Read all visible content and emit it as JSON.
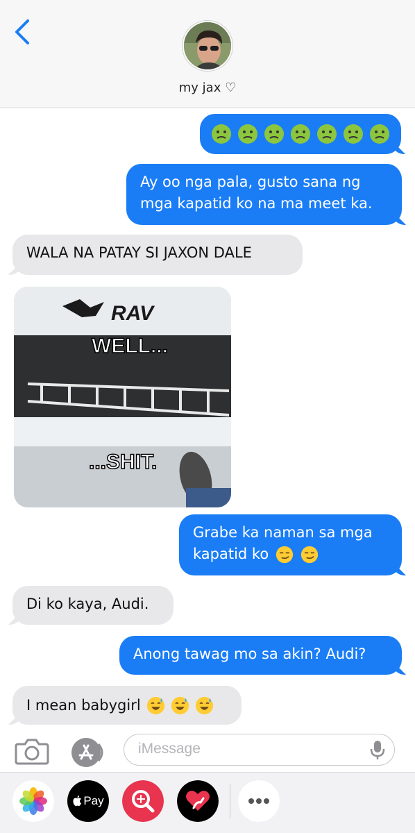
{
  "header": {
    "contact_name": "my jax ♡"
  },
  "messages": [
    {
      "side": "sent",
      "emoji": "nauseated-face-emoji",
      "emoji_count": 7
    },
    {
      "side": "sent",
      "lines": [
        "Ay oo nga pala, gusto sana ng",
        "mga kapatid ko na ma meet ka."
      ]
    },
    {
      "side": "received",
      "text": "WALA NA PATAY SI JAXON DALE"
    },
    {
      "side": "received",
      "image": "meme-photo",
      "caption_top": "WELL...",
      "caption_bottom": "...SHIT.",
      "sign_text": "RAV"
    },
    {
      "side": "sent",
      "lines": [
        "Grabe ka naman sa mga",
        "kapatid ko"
      ],
      "trailing_emoji": "smirk-face-emoji",
      "trailing_emoji_count": 2
    },
    {
      "side": "received",
      "text": "Di ko kaya, Audi."
    },
    {
      "side": "sent",
      "text": "Anong tawag mo sa akin? Audi?"
    },
    {
      "side": "received",
      "text": "I mean babygirl",
      "trailing_emoji": "sweat-smile-emoji",
      "trailing_emoji_count": 3
    }
  ],
  "compose": {
    "placeholder": "iMessage"
  },
  "drawer": {
    "apple_pay_label": "Pay"
  },
  "colors": {
    "sent_bubble": "#1a7df5",
    "received_bubble": "#e8e8ea",
    "accent": "#1a7df5"
  }
}
